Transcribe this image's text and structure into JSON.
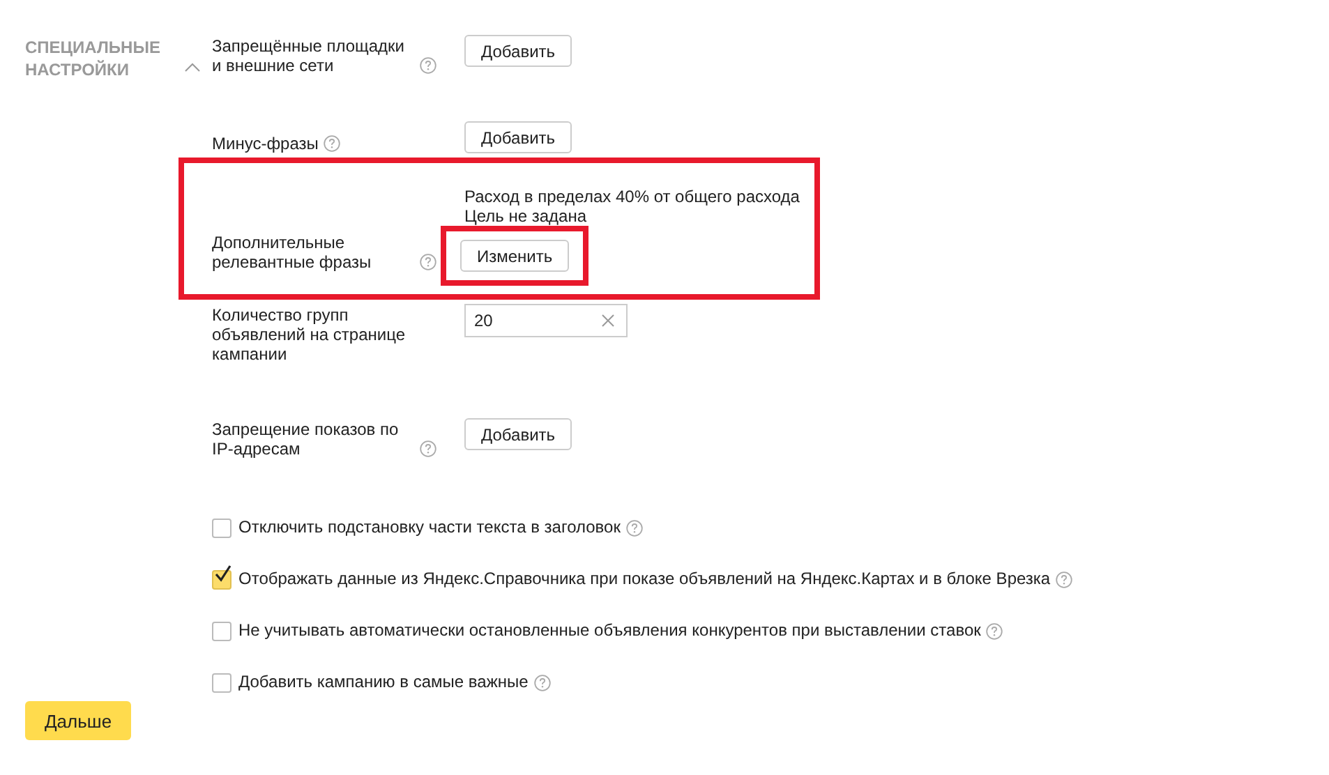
{
  "section": {
    "title": "СПЕЦИАЛЬНЫЕ НАСТРОЙКИ",
    "expanded": true
  },
  "rows": [
    {
      "kind": "button",
      "label": "Запрещённые площадки и внешние сети",
      "help": true,
      "button": "Добавить"
    },
    {
      "kind": "button",
      "label": "Минус-фразы",
      "help": true,
      "button": "Добавить"
    },
    {
      "kind": "value_button",
      "label": "Дополнительные релевантные фразы",
      "help": true,
      "lines": [
        "Расход в пределах 40% от общего расхода",
        "Цель не задана"
      ],
      "button": "Изменить",
      "highlighted": true,
      "button_highlighted": true
    },
    {
      "kind": "input",
      "label": "Количество групп объявлений на странице кампании",
      "help": false,
      "value": "20"
    },
    {
      "kind": "button",
      "label": "Запрещение показов по IP-адресам",
      "help": true,
      "button": "Добавить"
    }
  ],
  "checkboxes": [
    {
      "label": "Отключить подстановку части текста в заголовок",
      "checked": false
    },
    {
      "label": "Отображать данные из Яндекс.Справочника при показе объявлений на Яндекс.Картах и в блоке Врезка",
      "checked": true
    },
    {
      "label": "Не учитывать автоматически остановленные объявления конкурентов при выставлении ставок",
      "checked": false
    },
    {
      "label": "Добавить кампанию в самые важные",
      "checked": false
    }
  ],
  "next_button": "Дальше"
}
